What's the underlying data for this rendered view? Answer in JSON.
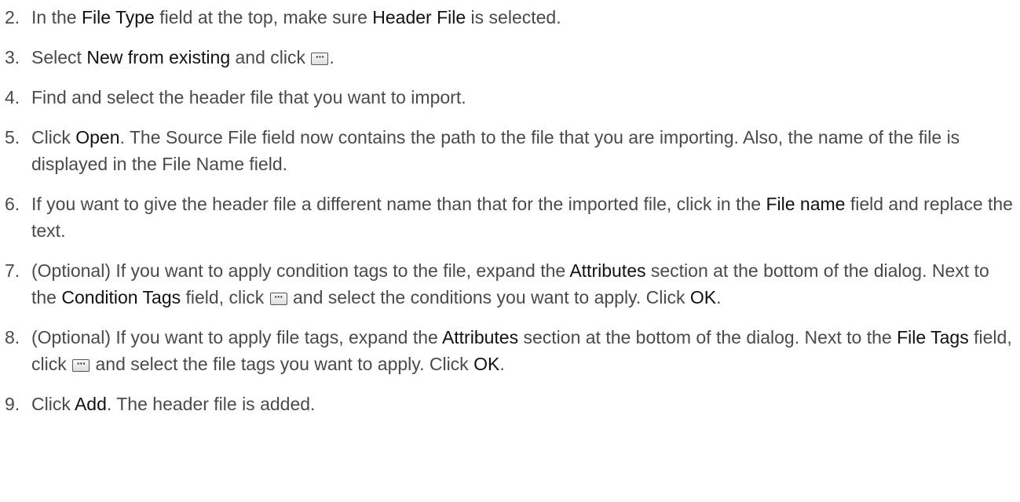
{
  "steps": [
    {
      "num": "2.",
      "parts": [
        "In the ",
        {
          "k": "File Type"
        },
        " field at the top, make sure ",
        {
          "k": "Header File"
        },
        " is selected."
      ]
    },
    {
      "num": "3.",
      "parts": [
        "Select ",
        {
          "k": "New from existing"
        },
        " and click ",
        {
          "icon": "browse-button-icon"
        },
        "."
      ]
    },
    {
      "num": "4.",
      "parts": [
        "Find and select the header file that you want to import."
      ]
    },
    {
      "num": "5.",
      "parts": [
        "Click ",
        {
          "k": "Open"
        },
        ". The Source File field now contains the path to the file that you are importing. Also, the name of the file is displayed in the File Name field."
      ]
    },
    {
      "num": "6.",
      "parts": [
        "If you want to give the header file a different name than that for the imported file, click in the ",
        {
          "k": "File name"
        },
        " field and replace the text."
      ]
    },
    {
      "num": "7.",
      "parts": [
        "(Optional) If you want to apply condition tags to the file, expand the ",
        {
          "k": "Attributes"
        },
        " section at the bottom of the dialog. Next to the ",
        {
          "k": "Condition Tags"
        },
        " field, click ",
        {
          "icon": "browse-button-icon"
        },
        " and select the conditions you want to apply. Click ",
        {
          "k": "OK"
        },
        "."
      ]
    },
    {
      "num": "8.",
      "parts": [
        "(Optional) If you want to apply file tags, expand the ",
        {
          "k": "Attributes"
        },
        " section at the bottom of the dialog. Next to the ",
        {
          "k": "File Tags"
        },
        " field, click ",
        {
          "icon": "browse-button-icon"
        },
        " and select the file tags you want to apply. Click ",
        {
          "k": "OK"
        },
        "."
      ]
    },
    {
      "num": "9.",
      "parts": [
        "Click ",
        {
          "k": "Add"
        },
        ". The header file is added."
      ]
    }
  ]
}
